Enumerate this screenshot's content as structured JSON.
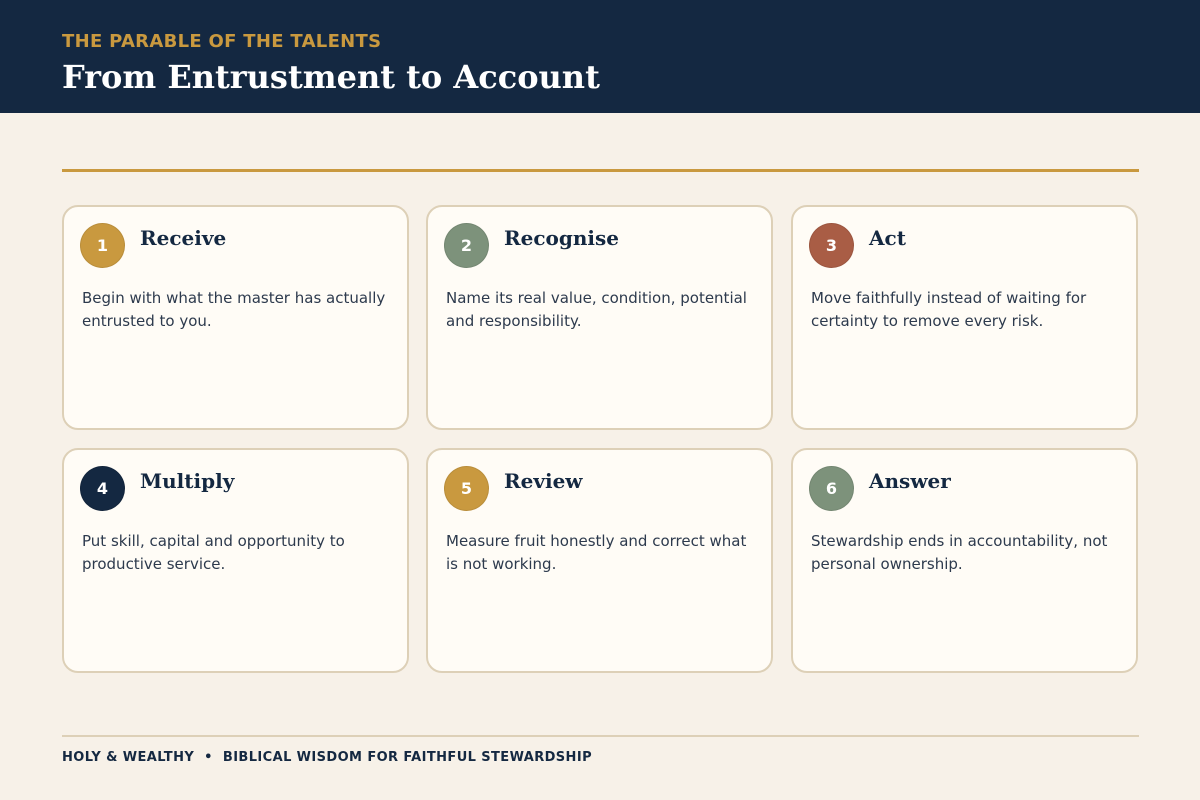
{
  "header": {
    "eyebrow": "THE PARABLE OF THE TALENTS",
    "title": "From Entrustment to Account"
  },
  "steps": [
    {
      "number": "1",
      "title": "Receive",
      "text": "Begin with what the master has actually entrusted to you.",
      "color": "#c9993f"
    },
    {
      "number": "2",
      "title": "Recognise",
      "text": "Name its real value, condition, potential and responsibility.",
      "color": "#7d927b"
    },
    {
      "number": "3",
      "title": "Act",
      "text": "Move faithfully instead of waiting for certainty to remove every risk.",
      "color": "#a95d45"
    },
    {
      "number": "4",
      "title": "Multiply",
      "text": "Put skill, capital and opportunity to productive service.",
      "color": "#142841"
    },
    {
      "number": "5",
      "title": "Review",
      "text": "Measure fruit honestly and correct what is not working.",
      "color": "#c9993f"
    },
    {
      "number": "6",
      "title": "Answer",
      "text": "Stewardship ends in accountability, not personal ownership.",
      "color": "#7d927b"
    }
  ],
  "footer": {
    "left": "HOLY & WEALTHY",
    "separator": "•",
    "right": "BIBLICAL WISDOM FOR FAITHFUL STEWARDSHIP"
  },
  "colors": {
    "navy": "#142841",
    "gold": "#c9993f",
    "cream": "#f7f1e8"
  }
}
